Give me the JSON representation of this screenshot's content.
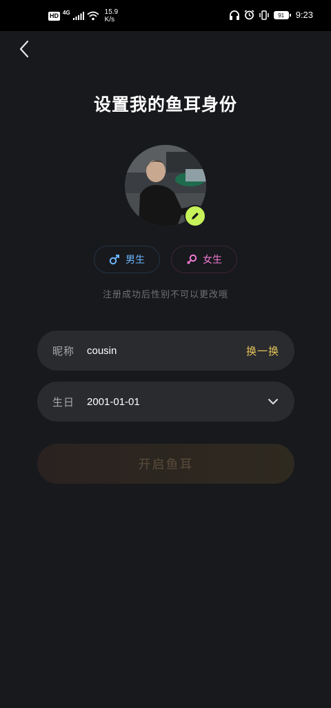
{
  "status_bar": {
    "hd": "HD",
    "network": "4G",
    "speed_value": "15.9",
    "speed_unit": "K/s",
    "battery": "91",
    "time": "9:23"
  },
  "page": {
    "title": "设置我的鱼耳身份"
  },
  "gender": {
    "male_label": "男生",
    "female_label": "女生",
    "male_color": "#6ab8ff",
    "female_color": "#f37bd4",
    "hint": "注册成功后性别不可以更改哦"
  },
  "form": {
    "nickname_label": "昵称",
    "nickname_value": "cousin",
    "refresh_label": "换一换",
    "birthday_label": "生日",
    "birthday_value": "2001-01-01"
  },
  "submit": {
    "label": "开启鱼耳"
  },
  "colors": {
    "background": "#18191d",
    "field_bg": "#2a2b2f",
    "accent_gold": "#e6c45a",
    "edit_badge": "#c8f25a"
  }
}
